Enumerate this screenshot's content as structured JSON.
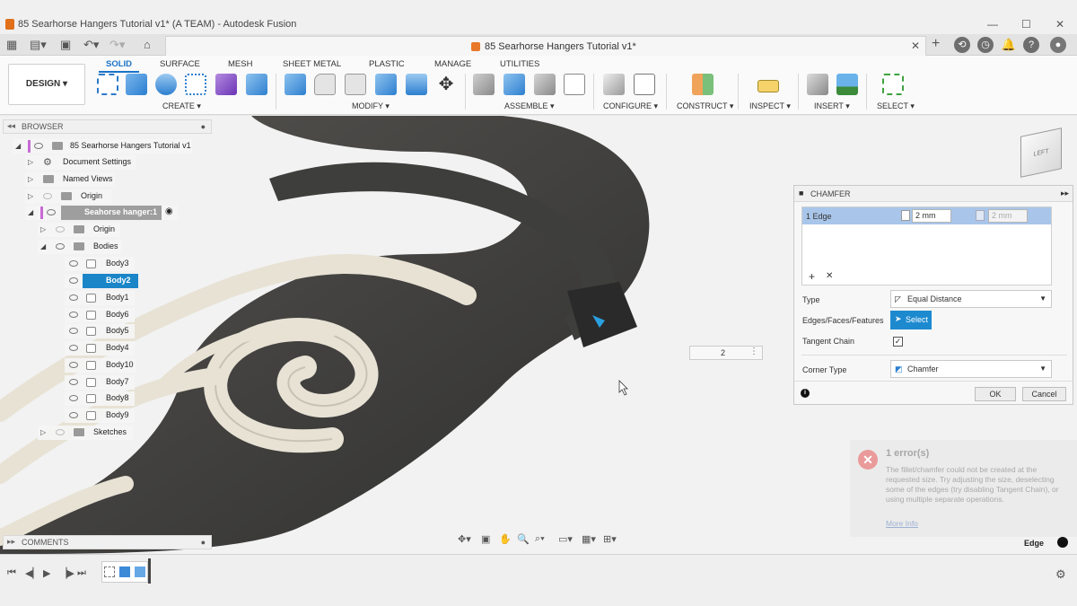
{
  "window": {
    "title": "85 Searhorse Hangers Tutorial v1* (A TEAM) - Autodesk Fusion",
    "minimize": "—",
    "maximize": "☐",
    "close": "✕"
  },
  "tabbar": {
    "doc_tab": "85 Searhorse Hangers Tutorial v1*",
    "close": "✕",
    "add": "+"
  },
  "ribbon": {
    "workspace": "DESIGN",
    "tabs": [
      "SOLID",
      "SURFACE",
      "MESH",
      "SHEET METAL",
      "PLASTIC",
      "MANAGE",
      "UTILITIES"
    ],
    "active_tab": "SOLID",
    "groups": [
      "CREATE",
      "MODIFY",
      "ASSEMBLE",
      "CONFIGURE",
      "CONSTRUCT",
      "INSPECT",
      "INSERT",
      "SELECT"
    ]
  },
  "browser": {
    "title": "BROWSER",
    "root": "85 Searhorse Hangers Tutorial v1",
    "document_settings": "Document Settings",
    "named_views": "Named Views",
    "origin": "Origin",
    "component": "Seahorse hanger:1",
    "sub_origin": "Origin",
    "bodies": "Bodies",
    "body_list": [
      "Body3",
      "Body2",
      "Body1",
      "Body6",
      "Body5",
      "Body4",
      "Body10",
      "Body7",
      "Body8",
      "Body9"
    ],
    "selected_body": "Body2",
    "sketches": "Sketches"
  },
  "chamfer": {
    "title": "CHAMFER",
    "edge_row": "1 Edge",
    "distance1": "2 mm",
    "distance2": "2 mm",
    "type_label": "Type",
    "type_value": "Equal Distance",
    "edges_label": "Edges/Faces/Features",
    "select_btn": "Select",
    "tangent_label": "Tangent Chain",
    "tangent_checked": true,
    "corner_label": "Corner Type",
    "corner_value": "Chamfer",
    "ok": "OK",
    "cancel": "Cancel"
  },
  "floating_input": "2",
  "error": {
    "title": "1 error(s)",
    "message": "The fillet/chamfer could not be created at the requested size. Try adjusting the size, deselecting some of the edges (try disabling Tangent Chain), or using multiple separate operations.",
    "link": "More Info"
  },
  "comments": "COMMENTS",
  "status": "Edge",
  "colors": {
    "accent": "#1a86c8",
    "selected_row": "#a9c6ea",
    "model_dark": "#404040",
    "model_light": "#e6e1d3"
  }
}
